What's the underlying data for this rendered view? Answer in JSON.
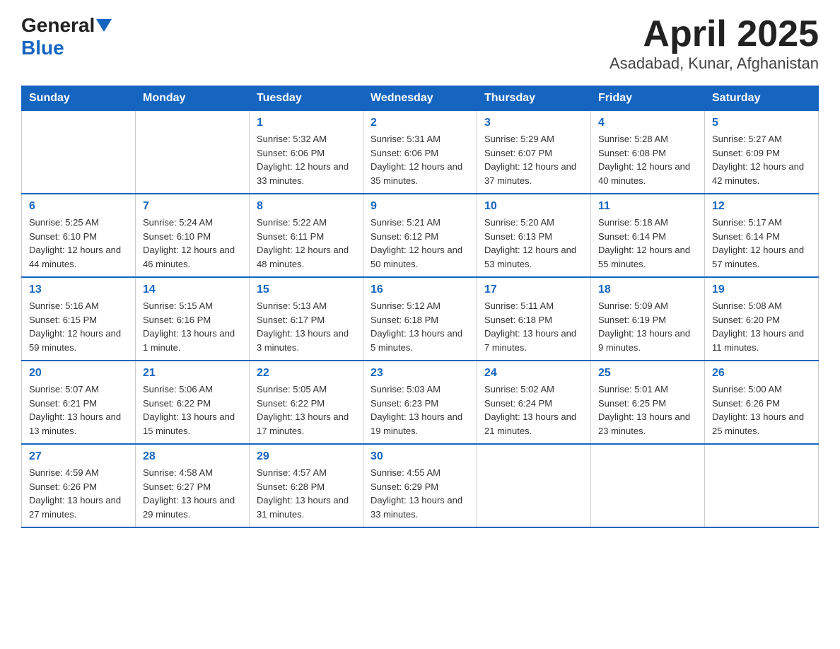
{
  "header": {
    "logo_general": "General",
    "logo_blue": "Blue",
    "title": "April 2025",
    "subtitle": "Asadabad, Kunar, Afghanistan"
  },
  "days_of_week": [
    "Sunday",
    "Monday",
    "Tuesday",
    "Wednesday",
    "Thursday",
    "Friday",
    "Saturday"
  ],
  "weeks": [
    [
      {
        "day": "",
        "info": ""
      },
      {
        "day": "",
        "info": ""
      },
      {
        "day": "1",
        "sunrise": "5:32 AM",
        "sunset": "6:06 PM",
        "daylight": "12 hours and 33 minutes."
      },
      {
        "day": "2",
        "sunrise": "5:31 AM",
        "sunset": "6:06 PM",
        "daylight": "12 hours and 35 minutes."
      },
      {
        "day": "3",
        "sunrise": "5:29 AM",
        "sunset": "6:07 PM",
        "daylight": "12 hours and 37 minutes."
      },
      {
        "day": "4",
        "sunrise": "5:28 AM",
        "sunset": "6:08 PM",
        "daylight": "12 hours and 40 minutes."
      },
      {
        "day": "5",
        "sunrise": "5:27 AM",
        "sunset": "6:09 PM",
        "daylight": "12 hours and 42 minutes."
      }
    ],
    [
      {
        "day": "6",
        "sunrise": "5:25 AM",
        "sunset": "6:10 PM",
        "daylight": "12 hours and 44 minutes."
      },
      {
        "day": "7",
        "sunrise": "5:24 AM",
        "sunset": "6:10 PM",
        "daylight": "12 hours and 46 minutes."
      },
      {
        "day": "8",
        "sunrise": "5:22 AM",
        "sunset": "6:11 PM",
        "daylight": "12 hours and 48 minutes."
      },
      {
        "day": "9",
        "sunrise": "5:21 AM",
        "sunset": "6:12 PM",
        "daylight": "12 hours and 50 minutes."
      },
      {
        "day": "10",
        "sunrise": "5:20 AM",
        "sunset": "6:13 PM",
        "daylight": "12 hours and 53 minutes."
      },
      {
        "day": "11",
        "sunrise": "5:18 AM",
        "sunset": "6:14 PM",
        "daylight": "12 hours and 55 minutes."
      },
      {
        "day": "12",
        "sunrise": "5:17 AM",
        "sunset": "6:14 PM",
        "daylight": "12 hours and 57 minutes."
      }
    ],
    [
      {
        "day": "13",
        "sunrise": "5:16 AM",
        "sunset": "6:15 PM",
        "daylight": "12 hours and 59 minutes."
      },
      {
        "day": "14",
        "sunrise": "5:15 AM",
        "sunset": "6:16 PM",
        "daylight": "13 hours and 1 minute."
      },
      {
        "day": "15",
        "sunrise": "5:13 AM",
        "sunset": "6:17 PM",
        "daylight": "13 hours and 3 minutes."
      },
      {
        "day": "16",
        "sunrise": "5:12 AM",
        "sunset": "6:18 PM",
        "daylight": "13 hours and 5 minutes."
      },
      {
        "day": "17",
        "sunrise": "5:11 AM",
        "sunset": "6:18 PM",
        "daylight": "13 hours and 7 minutes."
      },
      {
        "day": "18",
        "sunrise": "5:09 AM",
        "sunset": "6:19 PM",
        "daylight": "13 hours and 9 minutes."
      },
      {
        "day": "19",
        "sunrise": "5:08 AM",
        "sunset": "6:20 PM",
        "daylight": "13 hours and 11 minutes."
      }
    ],
    [
      {
        "day": "20",
        "sunrise": "5:07 AM",
        "sunset": "6:21 PM",
        "daylight": "13 hours and 13 minutes."
      },
      {
        "day": "21",
        "sunrise": "5:06 AM",
        "sunset": "6:22 PM",
        "daylight": "13 hours and 15 minutes."
      },
      {
        "day": "22",
        "sunrise": "5:05 AM",
        "sunset": "6:22 PM",
        "daylight": "13 hours and 17 minutes."
      },
      {
        "day": "23",
        "sunrise": "5:03 AM",
        "sunset": "6:23 PM",
        "daylight": "13 hours and 19 minutes."
      },
      {
        "day": "24",
        "sunrise": "5:02 AM",
        "sunset": "6:24 PM",
        "daylight": "13 hours and 21 minutes."
      },
      {
        "day": "25",
        "sunrise": "5:01 AM",
        "sunset": "6:25 PM",
        "daylight": "13 hours and 23 minutes."
      },
      {
        "day": "26",
        "sunrise": "5:00 AM",
        "sunset": "6:26 PM",
        "daylight": "13 hours and 25 minutes."
      }
    ],
    [
      {
        "day": "27",
        "sunrise": "4:59 AM",
        "sunset": "6:26 PM",
        "daylight": "13 hours and 27 minutes."
      },
      {
        "day": "28",
        "sunrise": "4:58 AM",
        "sunset": "6:27 PM",
        "daylight": "13 hours and 29 minutes."
      },
      {
        "day": "29",
        "sunrise": "4:57 AM",
        "sunset": "6:28 PM",
        "daylight": "13 hours and 31 minutes."
      },
      {
        "day": "30",
        "sunrise": "4:55 AM",
        "sunset": "6:29 PM",
        "daylight": "13 hours and 33 minutes."
      },
      {
        "day": "",
        "info": ""
      },
      {
        "day": "",
        "info": ""
      },
      {
        "day": "",
        "info": ""
      }
    ]
  ],
  "labels": {
    "sunrise_prefix": "Sunrise: ",
    "sunset_prefix": "Sunset: ",
    "daylight_prefix": "Daylight: "
  }
}
